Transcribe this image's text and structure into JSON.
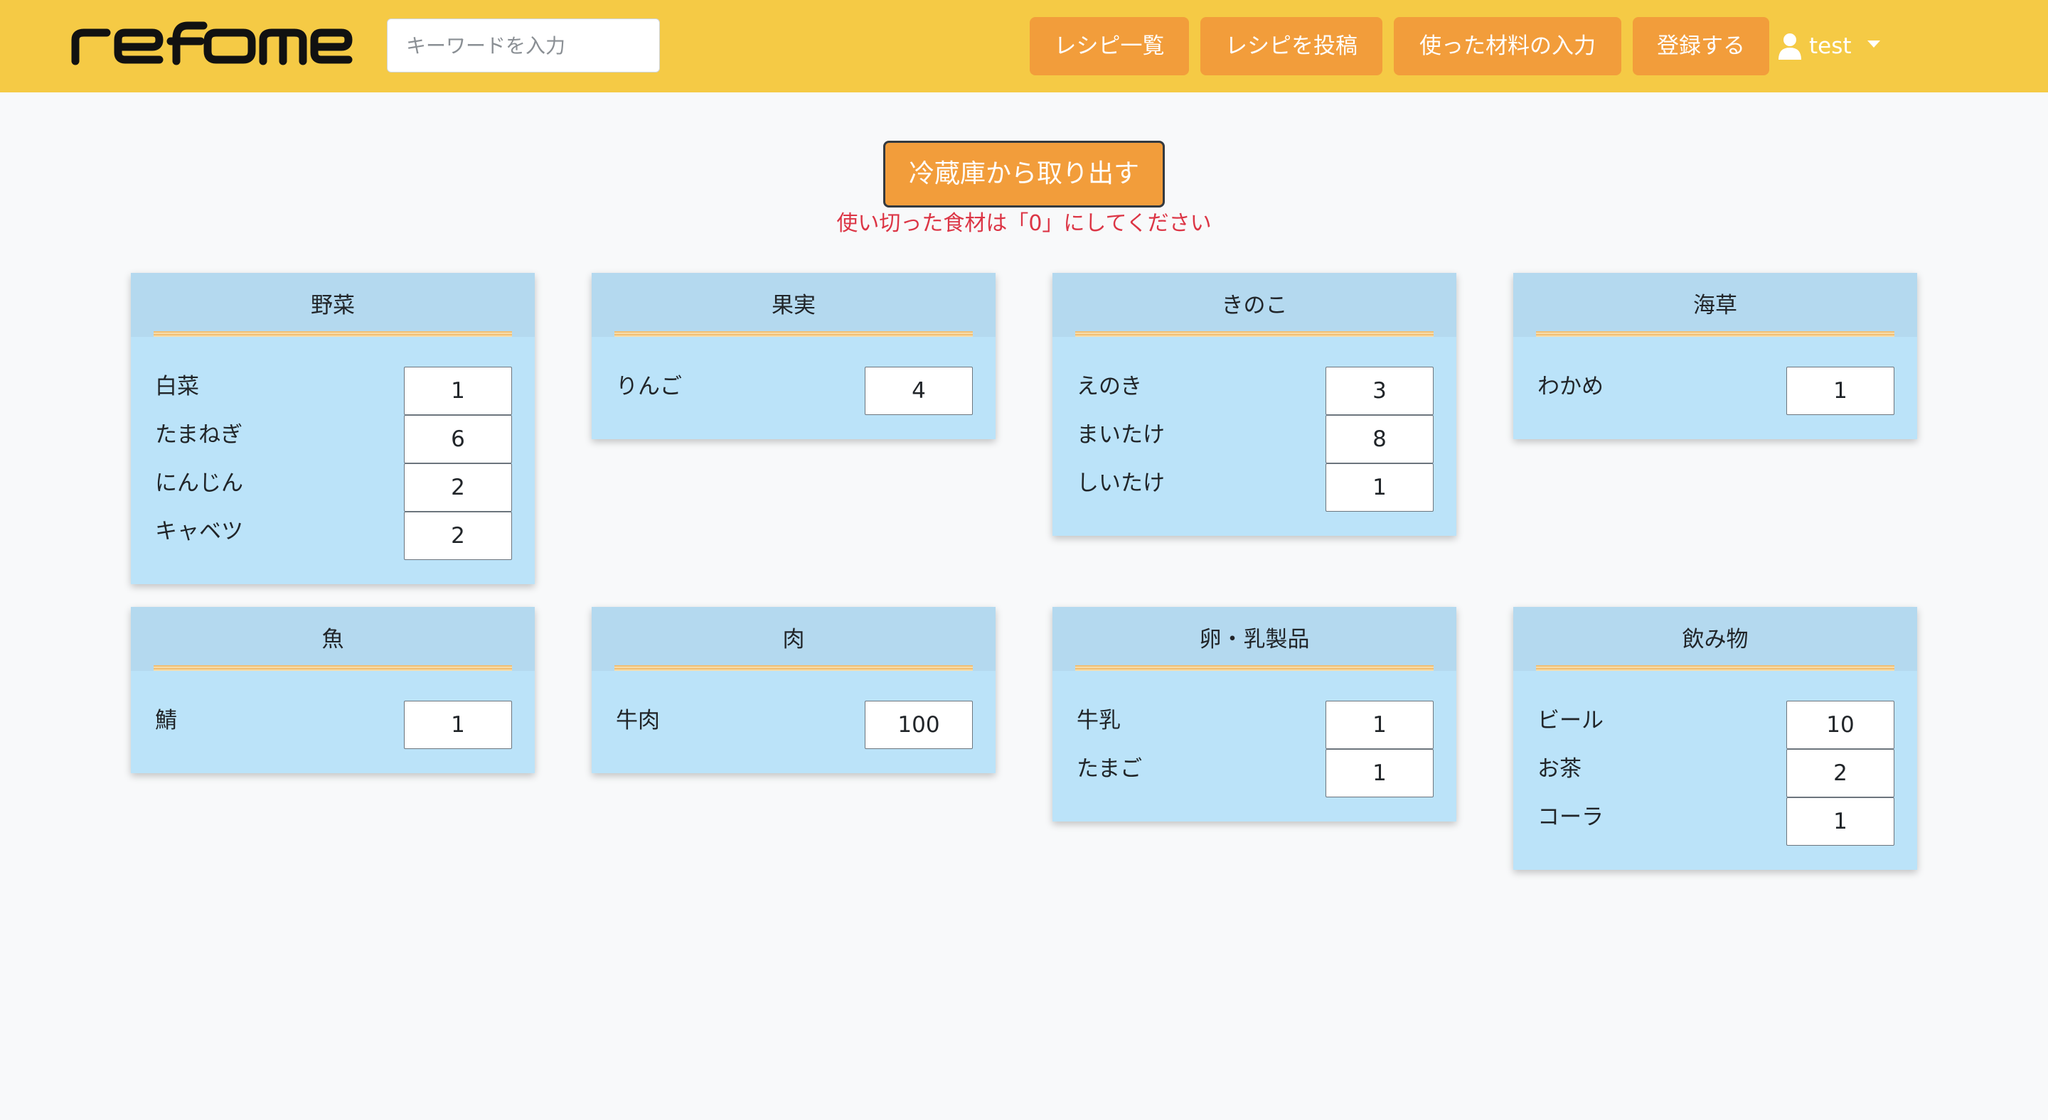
{
  "brand": {
    "name": "refome"
  },
  "search": {
    "placeholder": "キーワードを入力"
  },
  "nav": {
    "recipe_list": "レシピ一覧",
    "post_recipe": "レシピを投稿",
    "input_used": "使った材料の入力",
    "register": "登録する",
    "user": "test"
  },
  "main": {
    "take_out_button": "冷蔵庫から取り出す",
    "notice": "使い切った食材は「0」にしてください"
  },
  "categories": [
    {
      "title": "野菜",
      "items": [
        {
          "name": "白菜",
          "qty": "1"
        },
        {
          "name": "たまねぎ",
          "qty": "6"
        },
        {
          "name": "にんじん",
          "qty": "2"
        },
        {
          "name": "キャベツ",
          "qty": "2"
        }
      ]
    },
    {
      "title": "果実",
      "items": [
        {
          "name": "りんご",
          "qty": "4"
        }
      ]
    },
    {
      "title": "きのこ",
      "items": [
        {
          "name": "えのき",
          "qty": "3"
        },
        {
          "name": "まいたけ",
          "qty": "8"
        },
        {
          "name": "しいたけ",
          "qty": "1"
        }
      ]
    },
    {
      "title": "海草",
      "items": [
        {
          "name": "わかめ",
          "qty": "1"
        }
      ]
    },
    {
      "title": "魚",
      "items": [
        {
          "name": "鯖",
          "qty": "1"
        }
      ]
    },
    {
      "title": "肉",
      "items": [
        {
          "name": "牛肉",
          "qty": "100"
        }
      ]
    },
    {
      "title": "卵・乳製品",
      "items": [
        {
          "name": "牛乳",
          "qty": "1"
        },
        {
          "name": "たまご",
          "qty": "1"
        }
      ]
    },
    {
      "title": "飲み物",
      "items": [
        {
          "name": "ビール",
          "qty": "10"
        },
        {
          "name": "お茶",
          "qty": "2"
        },
        {
          "name": "コーラ",
          "qty": "1"
        }
      ]
    }
  ]
}
